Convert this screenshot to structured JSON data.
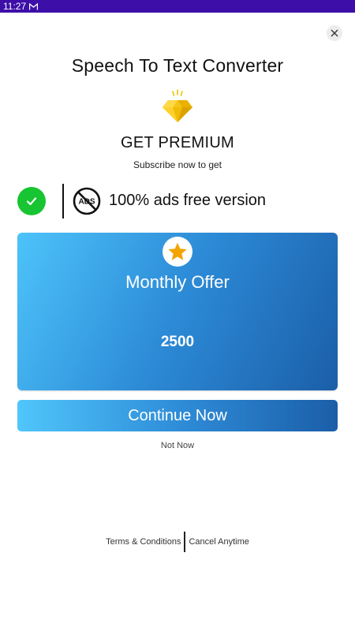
{
  "status_bar": {
    "time": "11:27",
    "notification_icon": "gmail-icon",
    "background": "#3d0fa8"
  },
  "close_icon": "close-icon",
  "app_title": "Speech To Text Converter",
  "header": {
    "icon": "diamond-icon",
    "title": "GET PREMIUM",
    "subtitle": "Subscribe now to get"
  },
  "feature": {
    "status_icon": "check-icon",
    "icon": "no-ads-icon",
    "icon_label": "ADS",
    "text": "100% ads free version"
  },
  "offer": {
    "icon": "star-icon",
    "title": "Monthly Offer",
    "price": "2500"
  },
  "actions": {
    "continue_label": "Continue Now",
    "not_now_label": "Not Now"
  },
  "footer": {
    "terms_label": "Terms & Conditions",
    "cancel_label": "Cancel Anytime"
  },
  "colors": {
    "accent_start": "#4dc3fa",
    "accent_end": "#1b5ea8",
    "check": "#16c531",
    "star": "#f4a300"
  }
}
